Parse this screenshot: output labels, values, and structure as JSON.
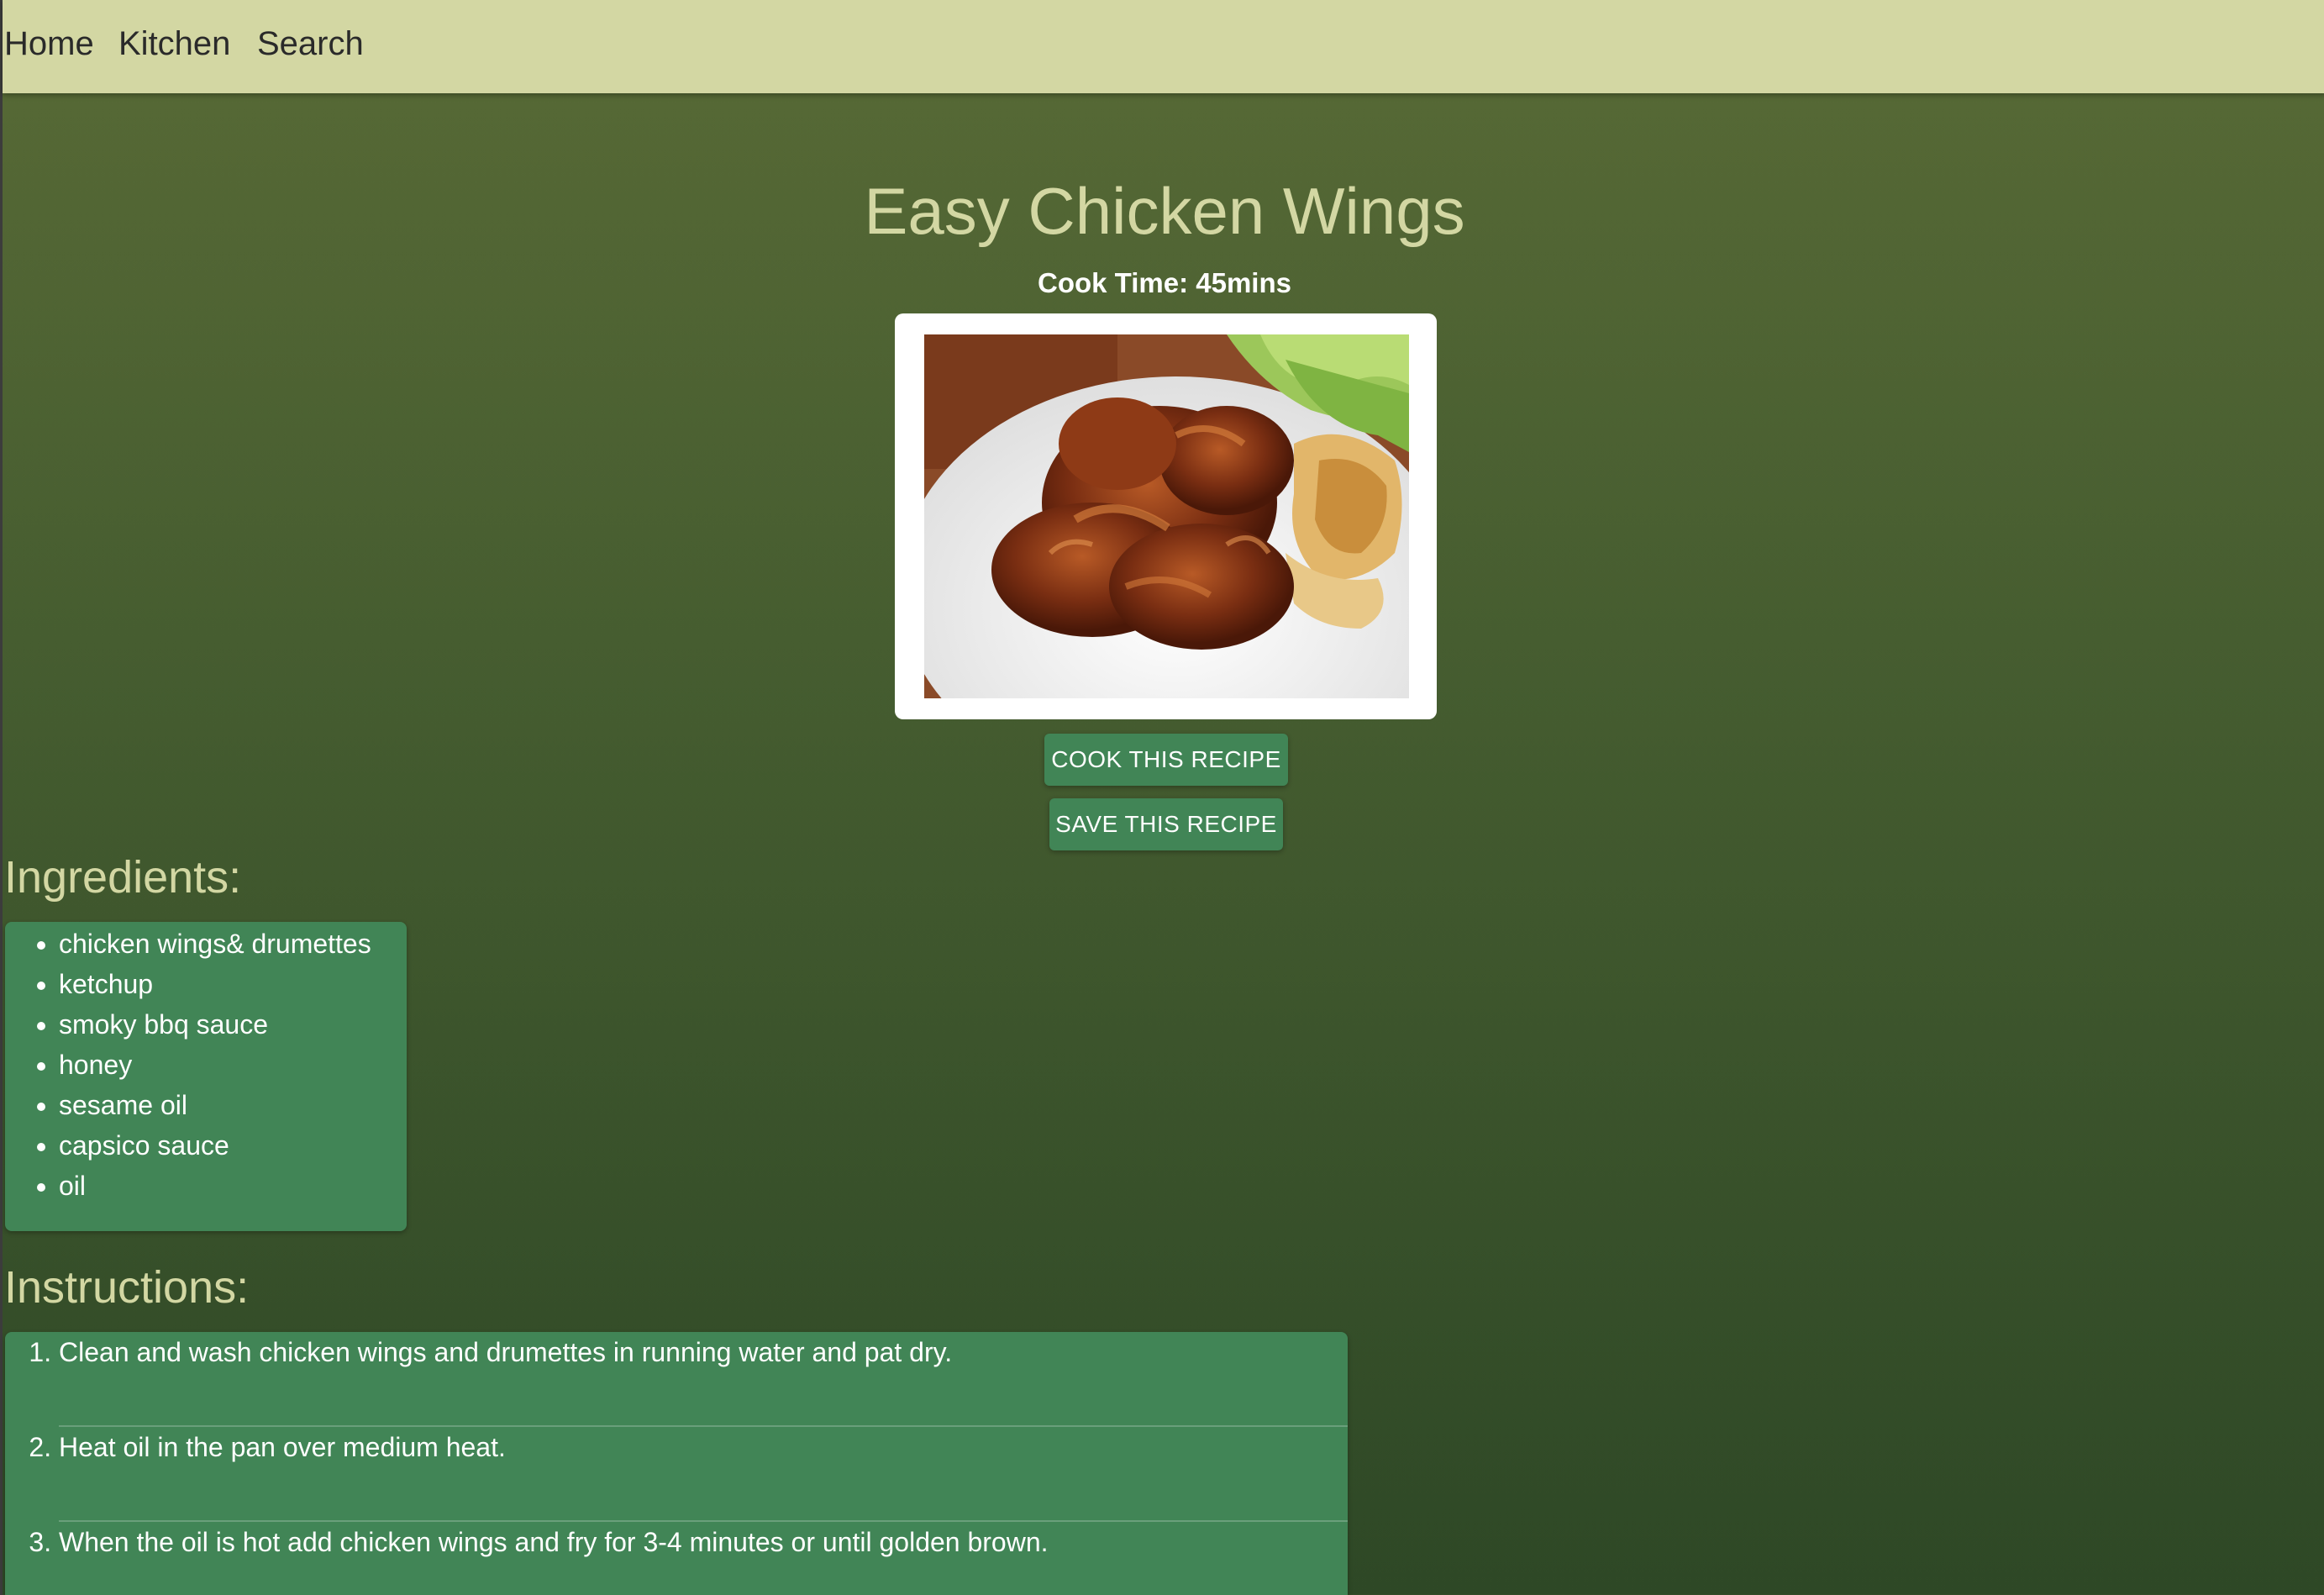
{
  "nav": {
    "items": [
      {
        "label": "Home"
      },
      {
        "label": "Kitchen"
      },
      {
        "label": "Search"
      }
    ]
  },
  "recipe": {
    "title": "Easy Chicken Wings",
    "cook_time": "Cook Time: 45mins"
  },
  "buttons": {
    "cook_label": "COOK THIS RECIPE",
    "save_label": "SAVE THIS RECIPE"
  },
  "ingredients": {
    "heading": "Ingredients:",
    "items": [
      "chicken wings& drumettes",
      "ketchup",
      "smoky bbq sauce",
      "honey",
      "sesame oil",
      "capsico sauce",
      "oil"
    ]
  },
  "instructions": {
    "heading": "Instructions:",
    "steps": [
      "Clean and wash chicken wings and drumettes in running water and pat dry.",
      "Heat oil in the pan over medium heat.",
      "When the oil is hot add chicken wings and fry for 3-4 minutes or until golden brown."
    ]
  },
  "colors": {
    "navbar": "#d3d7a3",
    "accent": "#418556",
    "heading": "#d3d7a3"
  },
  "icons": {
    "food_image": "chicken-wings-photo"
  }
}
